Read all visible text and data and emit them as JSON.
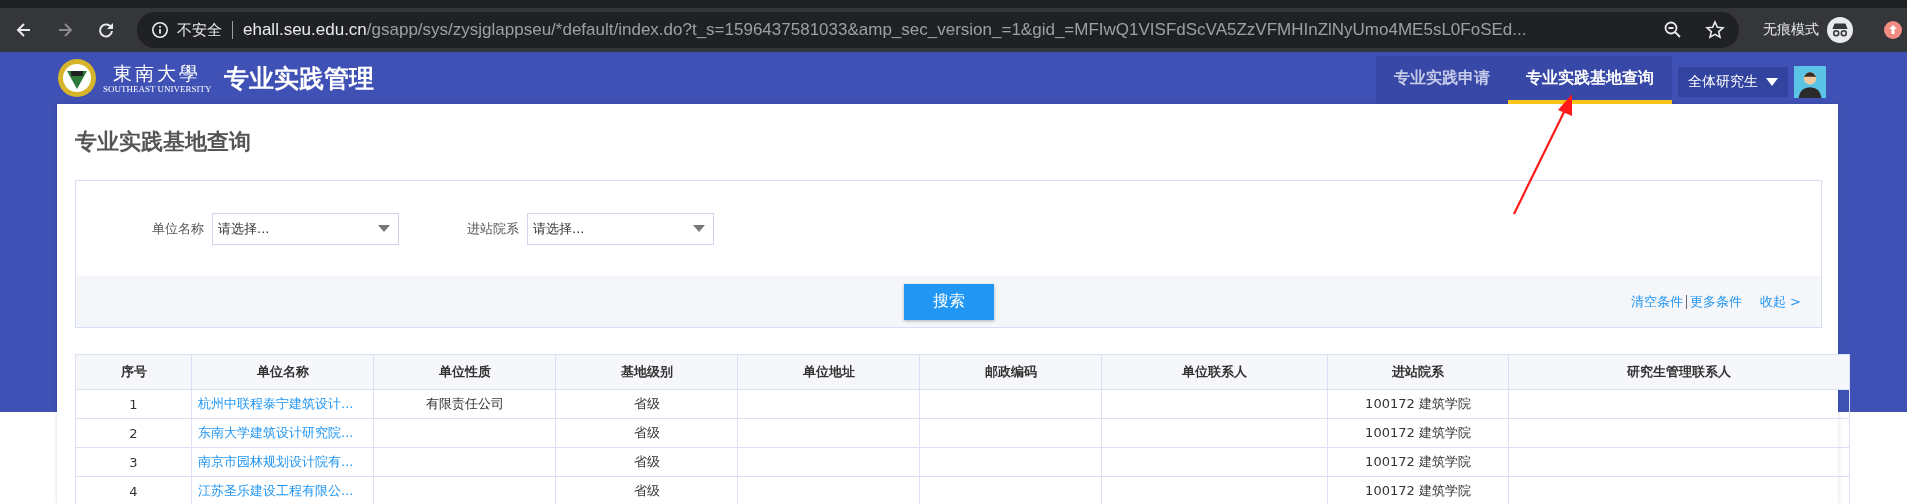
{
  "browser": {
    "security": "不安全",
    "host": "ehall.seu.edu.cn",
    "path": "/gsapp/sys/zysjglappseu/*default/index.do?t_s=1596437581033&amp_sec_version_=1&gid_=MFIwQ1VISFdScVA5ZzVFMHInZlNyUmo4ME5sL0FoSEd...",
    "incognito": "无痕模式"
  },
  "header": {
    "logo_text": "東南大學",
    "logo_subtext": "SOUTHEAST UNIVERSITY",
    "title": "专业实践管理",
    "tabs": [
      {
        "label": "专业实践申请",
        "selected": false
      },
      {
        "label": "专业实践基地查询",
        "selected": true
      }
    ],
    "role": "全体研究生"
  },
  "page_title": "专业实践基地查询",
  "filters": [
    {
      "label": "单位名称",
      "placeholder": "请选择..."
    },
    {
      "label": "进站院系",
      "placeholder": "请选择..."
    }
  ],
  "search_button": "搜索",
  "links": [
    "清空条件",
    "更多条件",
    "收起 >"
  ],
  "table": {
    "columns": [
      "序号",
      "单位名称",
      "单位性质",
      "基地级别",
      "单位地址",
      "邮政编码",
      "单位联系人",
      "进站院系",
      "研究生管理联系人"
    ],
    "rows": [
      [
        "1",
        "杭州中联程泰宁建筑设计...",
        "有限责任公司",
        "省级",
        "",
        "",
        "",
        "100172 建筑学院",
        ""
      ],
      [
        "2",
        "东南大学建筑设计研究院...",
        "",
        "省级",
        "",
        "",
        "",
        "100172 建筑学院",
        ""
      ],
      [
        "3",
        "南京市园林规划设计院有...",
        "",
        "省级",
        "",
        "",
        "",
        "100172 建筑学院",
        ""
      ],
      [
        "4",
        "江苏圣乐建设工程有限公...",
        "",
        "省级",
        "",
        "",
        "",
        "100172 建筑学院",
        ""
      ]
    ]
  }
}
